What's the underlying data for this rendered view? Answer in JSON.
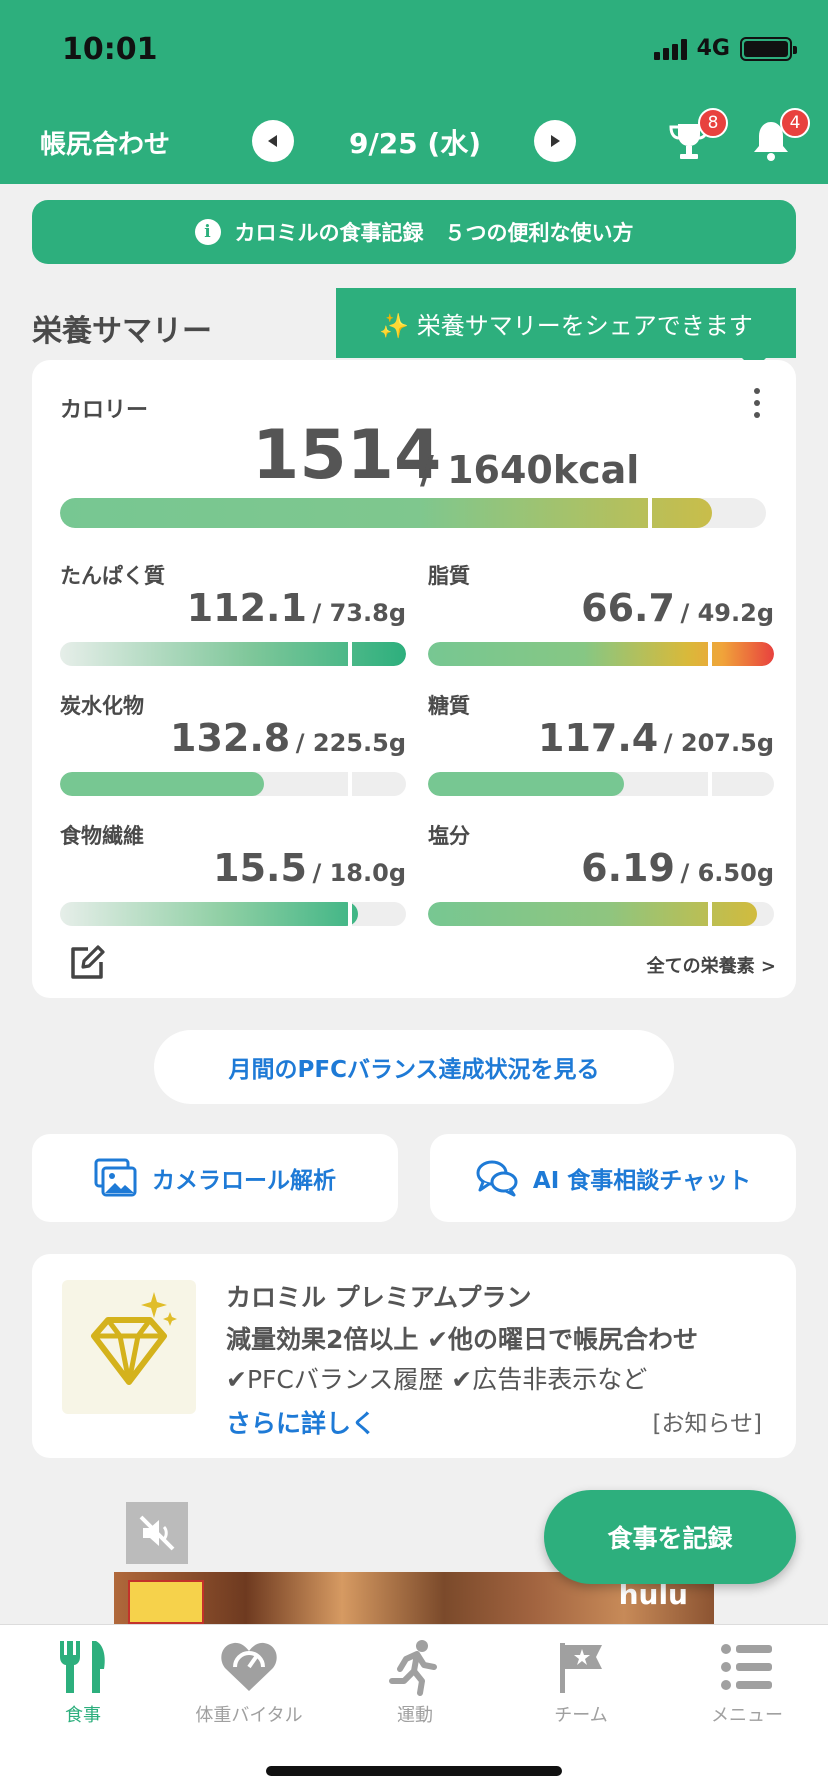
{
  "status": {
    "time": "10:01",
    "network": "4G"
  },
  "header": {
    "title": "帳尻合わせ",
    "date": "9/25 (水)",
    "trophy_count": "8",
    "notification_count": "4"
  },
  "info_banner": {
    "text": "カロミルの食事記録　５つの便利な使い方"
  },
  "summary": {
    "title": "栄養サマリー",
    "share_tip": "✨ 栄養サマリーをシェアできます",
    "calorie": {
      "label": "カロリー",
      "value": "1514",
      "target": "/ 1640kcal",
      "ratio": 0.923
    },
    "nutrients": [
      {
        "label": "たんぱく質",
        "value": "112.1",
        "target": "/ 73.8g",
        "ratio": 1.0
      },
      {
        "label": "脂質",
        "value": "66.7",
        "target": "/ 49.2g",
        "ratio": 1.0
      },
      {
        "label": "炭水化物",
        "value": "132.8",
        "target": "/ 225.5g",
        "ratio": 0.589
      },
      {
        "label": "糖質",
        "value": "117.4",
        "target": "/ 207.5g",
        "ratio": 0.566
      },
      {
        "label": "食物繊維",
        "value": "15.5",
        "target": "/ 18.0g",
        "ratio": 0.861
      },
      {
        "label": "塩分",
        "value": "6.19",
        "target": "/ 6.50g",
        "ratio": 0.952
      }
    ],
    "all_link": "全ての栄養素 >"
  },
  "pfc_button": "月間のPFCバランス達成状況を見る",
  "camera_button": "カメラロール解析",
  "chat_button": "AI 食事相談チャット",
  "premium": {
    "title": "カロミル プレミアムプラン",
    "line1": "減量効果2倍以上 ✔他の曜日で帳尻合わせ",
    "line2": "✔PFCバランス履歴 ✔広告非表示など",
    "link": "さらに詳しく",
    "notice": "[お知らせ]"
  },
  "ad": {
    "brand": "hulu"
  },
  "record_button": "食事を記録",
  "tabs": [
    {
      "label": "食事",
      "icon": "fork-knife-icon"
    },
    {
      "label": "体重バイタル",
      "icon": "heart-gauge-icon"
    },
    {
      "label": "運動",
      "icon": "running-icon"
    },
    {
      "label": "チーム",
      "icon": "flag-star-icon"
    },
    {
      "label": "メニュー",
      "icon": "list-menu-icon"
    }
  ],
  "colors": {
    "brand": "#2daf7d",
    "link": "#1e7ad6",
    "badge": "#e8413e"
  }
}
